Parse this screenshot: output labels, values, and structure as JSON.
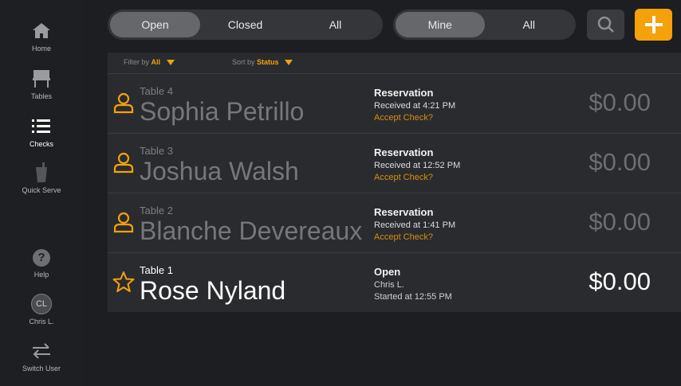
{
  "sidebar": {
    "items": [
      {
        "label": "Home",
        "icon": "home-icon"
      },
      {
        "label": "Tables",
        "icon": "table-icon"
      },
      {
        "label": "Checks",
        "icon": "list-icon",
        "active": true
      },
      {
        "label": "Quick Serve",
        "icon": "cup-icon"
      },
      {
        "label": "Help",
        "icon": "help-icon"
      },
      {
        "label": "Chris L.",
        "icon": "avatar",
        "initials": "CL"
      },
      {
        "label": "Switch User",
        "icon": "switch-user-icon"
      }
    ]
  },
  "toolbar": {
    "status_filter": [
      "Open",
      "Closed",
      "All"
    ],
    "status_selected": "Open",
    "owner_filter": [
      "Mine",
      "All"
    ],
    "owner_selected": "Mine"
  },
  "filters": {
    "filter_label": "Filter by",
    "filter_value": "All",
    "sort_label": "Sort by",
    "sort_value": "Status"
  },
  "checks": [
    {
      "table": "Table 4",
      "name": "Sophia Petrillo",
      "status": "Reservation",
      "detail": "Received at 4:21 PM",
      "action": "Accept Check?",
      "amount": "$0.00",
      "icon": "person-icon"
    },
    {
      "table": "Table 3",
      "name": "Joshua Walsh",
      "status": "Reservation",
      "detail": "Received at 12:52 PM",
      "action": "Accept Check?",
      "amount": "$0.00",
      "icon": "person-icon"
    },
    {
      "table": "Table 2",
      "name": "Blanche Devereaux",
      "status": "Reservation",
      "detail": "Received at 1:41 PM",
      "action": "Accept Check?",
      "amount": "$0.00",
      "icon": "person-icon"
    },
    {
      "table": "Table 1",
      "name": "Rose Nyland",
      "status": "Open",
      "detail": "Chris L.",
      "detail2": "Started at 12:55 PM",
      "amount": "$0.00",
      "icon": "star-icon"
    }
  ],
  "colors": {
    "accent": "#f5a10a",
    "background": "#1d1e21",
    "panel": "#2a2b2e"
  }
}
